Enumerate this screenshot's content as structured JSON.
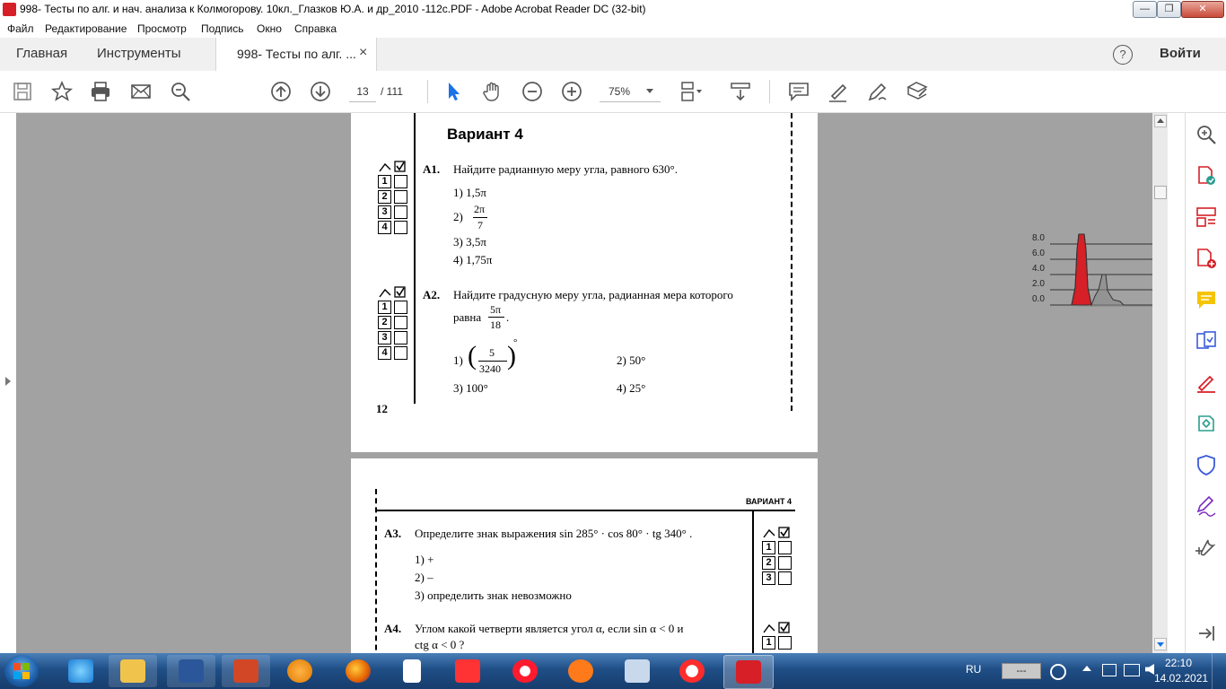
{
  "window": {
    "title": "998- Тесты по алг. и нач. анализа к Колмогорову. 10кл._Глазков Ю.А. и др_2010 -112с.PDF - Adobe Acrobat Reader DC (32-bit)",
    "minimize": "—",
    "maximize": "❐",
    "close": "✕"
  },
  "menu": [
    "Файл",
    "Редактирование",
    "Просмотр",
    "Подпись",
    "Окно",
    "Справка"
  ],
  "tabs": {
    "home": "Главная",
    "tools": "Инструменты",
    "document": "998- Тесты по алг. ...",
    "close": "×",
    "help": "?",
    "signin": "Войти"
  },
  "toolbar": {
    "page_current": "13",
    "page_total": "/ 111",
    "zoom": "75%"
  },
  "page1": {
    "variant": "Вариант 4",
    "a1": {
      "num": "А1.",
      "question": "Найдите радианную меру угла, равного 630°.",
      "opt1": "1)  1,5π",
      "opt2_num": "2)",
      "opt2_top": "2π",
      "opt2_bottom": "7",
      "opt3": "3)  3,5π",
      "opt4": "4)  1,75π"
    },
    "a2": {
      "num": "А2.",
      "question": "Найдите градусную меру угла, радианная мера которого",
      "question2": "равна",
      "frac_top": "5π",
      "frac_bottom": "18",
      "dot": ".",
      "opt1_num": "1)",
      "opt1_top": "5",
      "opt1_bottom": "3240",
      "opt1_deg": "°",
      "opt2": "2)  50°",
      "opt3": "3)  100°",
      "opt4": "4)  25°"
    },
    "page_number": "12",
    "box_labels": [
      "1",
      "2",
      "3",
      "4"
    ]
  },
  "page2": {
    "header": "ВАРИАНТ 4",
    "a3": {
      "num": "А3.",
      "question": "Определите знак выражения sin 285° · cos 80° · tg 340° .",
      "opt1": "1)  +",
      "opt2": "2)  –",
      "opt3": "3)  определить знак невозможно"
    },
    "a4": {
      "num": "А4.",
      "question": "Углом какой четверти является угол α,  если  sin α < 0  и",
      "question2": "ctg α < 0 ?"
    },
    "box_labels": [
      "1",
      "2",
      "3"
    ]
  },
  "overlay_chart": {
    "tick_labels": [
      "8.0",
      "6.0",
      "4.0",
      "2.0",
      "0.0"
    ]
  },
  "tray": {
    "lang": "RU",
    "time": "22:10",
    "date": "14.02.2021",
    "battery": "---"
  },
  "colors": {
    "accent_red": "#d61f26",
    "viewport_gray": "#a2a2a2",
    "taskbar": "#1f4e86"
  }
}
